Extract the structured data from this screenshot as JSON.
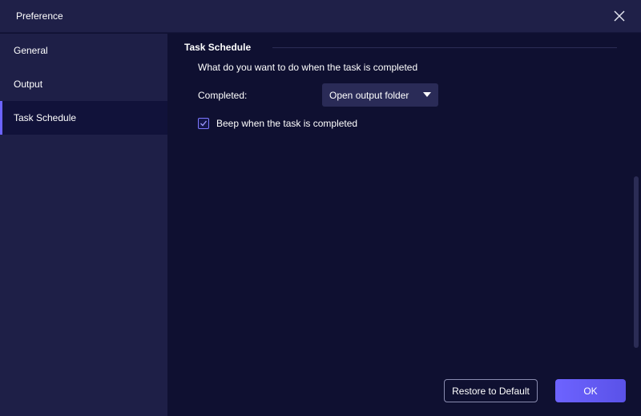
{
  "window": {
    "title": "Preference",
    "close_icon": "close-icon"
  },
  "sidebar": {
    "items": [
      {
        "label": "General",
        "active": false
      },
      {
        "label": "Output",
        "active": false
      },
      {
        "label": "Task Schedule",
        "active": true
      }
    ]
  },
  "section": {
    "title": "Task Schedule",
    "question": "What do you want to do when the task is completed",
    "completed_label": "Completed:",
    "completed_value": "Open output folder",
    "beep_label": "Beep when the task is completed",
    "beep_checked": true
  },
  "footer": {
    "restore_label": "Restore to Default",
    "ok_label": "OK"
  },
  "colors": {
    "accent": "#6c63ff",
    "background": "#0f1031",
    "sidebar": "#1e1f47"
  }
}
